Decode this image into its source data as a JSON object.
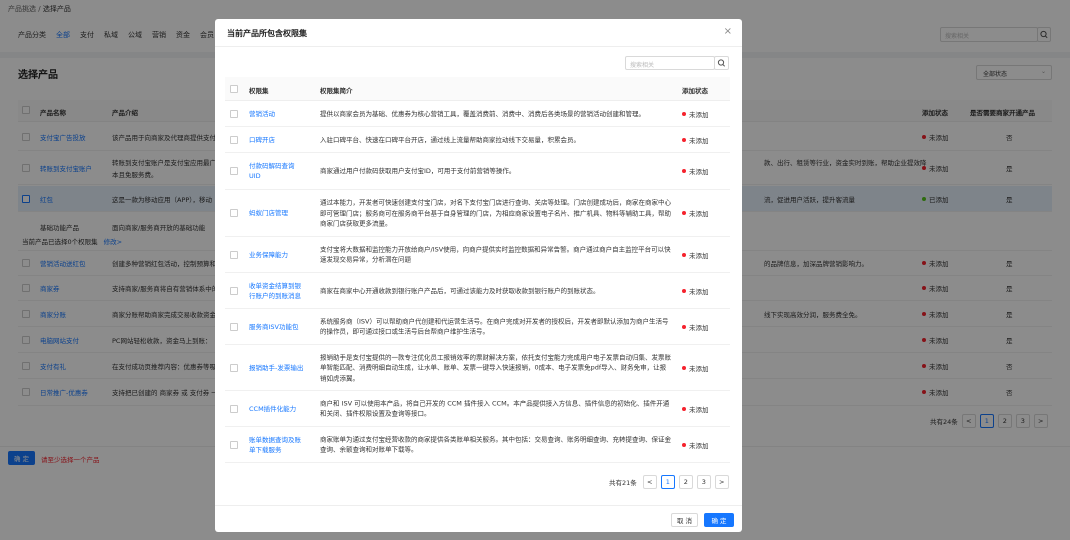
{
  "breadcrumb": {
    "parent": "产品挑选",
    "sep": "/",
    "current": "选择产品"
  },
  "categories": [
    "产品分类",
    "全部",
    "支付",
    "私域",
    "公域",
    "营销",
    "资金",
    "会员"
  ],
  "bg_search": {
    "placeholder": "搜索相关"
  },
  "page_title": "选择产品",
  "status_filter": "全部状态",
  "bg_table": {
    "headers": {
      "name": "产品名称",
      "intro": "产品介绍",
      "status": "添加状态",
      "must": "是否需要商家开通产品"
    },
    "rows": [
      {
        "name": "支付宝广告投放",
        "desc": "该产品用于向商家及代理商提供支付",
        "desc2": "",
        "status": "未添加",
        "must": "否"
      },
      {
        "name": "转账到支付宝账户",
        "desc": "转账到支付宝账户是支付宝应用最广",
        "desc2": "款、出行、租赁等行业，资金实时到账，帮助企业提效降",
        "desc2b": "本且免服务费。",
        "status": "未添加",
        "must": "是"
      },
      {
        "name": "红包",
        "desc": "这是一款为移动应用（APP），移动",
        "desc2": "流，促进用户活跃，提升客流量",
        "status": "已添加",
        "must": "是"
      },
      {
        "name": "基础功能产品",
        "desc": "面向商家/服务商开放的基础功能",
        "desc2": "",
        "status": "",
        "must": ""
      },
      {
        "name": "营销活动送红包",
        "desc": "创建多种营销红包活动，控制预算和",
        "desc2": "的品牌信息，加深品牌营销影响力。",
        "status": "未添加",
        "must": "是"
      },
      {
        "name": "商家券",
        "desc": "支持商家/服务商将自有营销体系中的",
        "desc2": "",
        "status": "未添加",
        "must": "是"
      },
      {
        "name": "商家分账",
        "desc": "商家分账帮助商家完成交易收款资金",
        "desc2": "线下实现高效分润，服务费全免。",
        "status": "未添加",
        "must": "是"
      },
      {
        "name": "电脑网站支付",
        "desc": "PC网站轻松收款，资金马上到账：",
        "desc2": "",
        "status": "未添加",
        "must": "是"
      },
      {
        "name": "支付有礼",
        "desc": "在支付成功页推荐内容：优惠券等吸",
        "desc2": "",
        "status": "未添加",
        "must": "否"
      },
      {
        "name": "日常推广-优惠券",
        "desc": "支持把已创建的 商家券 或 支付券 一",
        "desc2": "",
        "status": "未添加",
        "must": "否"
      }
    ],
    "basic_selected_text": "当前产品已选择0个权限集",
    "basic_modify_link": "修改>"
  },
  "bg_pager": {
    "total": "共有24条",
    "pages": [
      "1",
      "2",
      "3"
    ],
    "prev": "<",
    "next": ">"
  },
  "bg_footer": {
    "confirm": "确 定",
    "hint": "请至少选择一个产品"
  },
  "modal": {
    "title": "当前产品所包含权限集",
    "close_glyph": "×",
    "search_placeholder": "搜索相关",
    "headers": {
      "perm": "权限集",
      "intro": "权限集简介",
      "status": "添加状态"
    },
    "rows": [
      {
        "perm": "营销活动",
        "intro": "提供以商家会员为基础、优惠券为核心营销工具，覆盖消费前、消费中、消费后各类场景的营销活动创建和管理。",
        "status": "未添加"
      },
      {
        "perm": "口碑开店",
        "intro": "入驻口碑平台、快速在口碑平台开店，通过线上流量帮助商家拉动线下交易量，积累会员。",
        "status": "未添加"
      },
      {
        "perm": "付款码解码查询UID",
        "intro": "商家通过用户付款码获取用户支付宝ID，可用于支付前营销等操作。",
        "status": "未添加"
      },
      {
        "perm": "蚂蚁门店管理",
        "intro": "通过本能力，开发者可快速创建支付宝门店，对名下支付宝门店进行查询、关店等处理。门店创建成功后，商家在商家中心即可管理门店；服务商可在服务商平台基于自身管理的门店，为相应商家设置电子名片、推广机具、物料等辅助工具，帮助商家门店获取更多流量。",
        "status": "未添加"
      },
      {
        "perm": "业务保障能力",
        "intro": "支付宝将大数据和监控能力开放给商户/ISV使用，向商户提供实时监控数据和异常告警。商户通过商户自主监控平台可以快速发现交易异常，分析潜在问题",
        "status": "未添加"
      },
      {
        "perm": "收单资金结算到银行账户的到账消息",
        "intro": "商家在商家中心开通收款到银行账户产品后，可通过该能力及时获取收款到银行账户的到账状态。",
        "status": "未添加"
      },
      {
        "perm": "服务商ISV功能包",
        "intro": "系统服务商（ISV）可以帮助商户代创建和代运营生活号。在商户完成对开发者的授权后，开发者即默认添加为商户生活号的操作员，即可通过接口或生活号后台帮商户维护生活号。",
        "status": "未添加"
      },
      {
        "perm": "报销助手-发票输出",
        "intro": "报销助手是支付宝提供的一款专注优化员工报销效率的票财解决方案，依托支付宝能力完成用户电子发票自动归集、发票账单智能匹配、消费明细自动生成，让水单、账单、发票一键导入快速报销，0成本、电子发票免pdf导入、财务免审，让报销如虎添翼。",
        "status": "未添加"
      },
      {
        "perm": "CCM插件化能力",
        "intro": "商户和 ISV 可以使用本产品，将自己开发的 CCM 插件接入 CCM。本产品提供接入方信息、插件信息的初始化、插件开通和关闭、插件权限设置及查询等接口。",
        "status": "未添加"
      },
      {
        "perm": "账单数据查询及账单下载服务",
        "intro": "商家账单为通过支付宝经营收款的商家提供各类账单相关服务。其中包括：交易查询、账务明细查询、充转提查询、保证金查询、余额查询和对账单下载等。",
        "status": "未添加"
      }
    ],
    "pager": {
      "total": "共有21条",
      "pages": [
        "1",
        "2",
        "3"
      ],
      "prev": "<",
      "next": ">"
    },
    "cancel": "取 消",
    "ok": "确 定"
  },
  "colors": {
    "primary": "#1677ff",
    "status_unadded": "#f5222d",
    "status_added": "#52c41a"
  }
}
